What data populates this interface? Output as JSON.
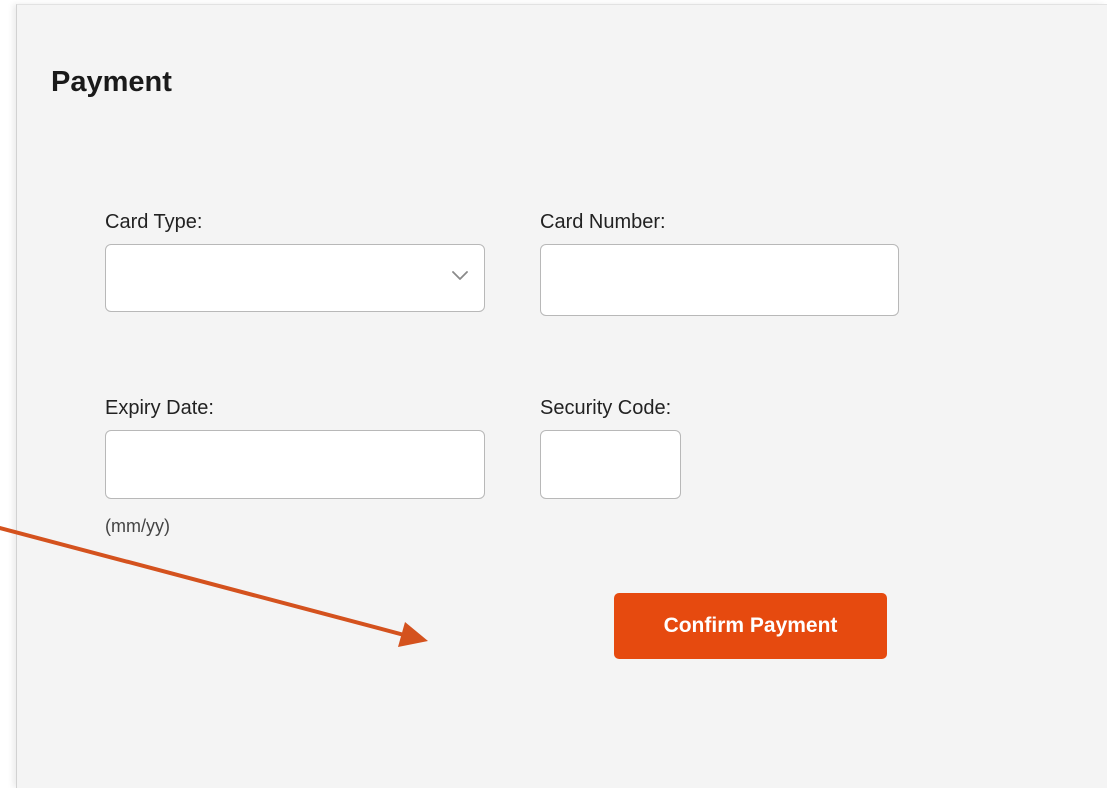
{
  "title": "Payment",
  "fields": {
    "card_type": {
      "label": "Card Type:",
      "value": ""
    },
    "card_number": {
      "label": "Card Number:",
      "value": ""
    },
    "expiry_date": {
      "label": "Expiry Date:",
      "value": "",
      "hint": "(mm/yy)"
    },
    "security_code": {
      "label": "Security Code:",
      "value": ""
    }
  },
  "buttons": {
    "confirm_label": "Confirm Payment"
  },
  "colors": {
    "accent": "#e64a0f",
    "panel_bg": "#f4f4f4"
  },
  "icons": {
    "select_chevron": "chevron-down-icon",
    "annotation": "annotation-arrow"
  }
}
